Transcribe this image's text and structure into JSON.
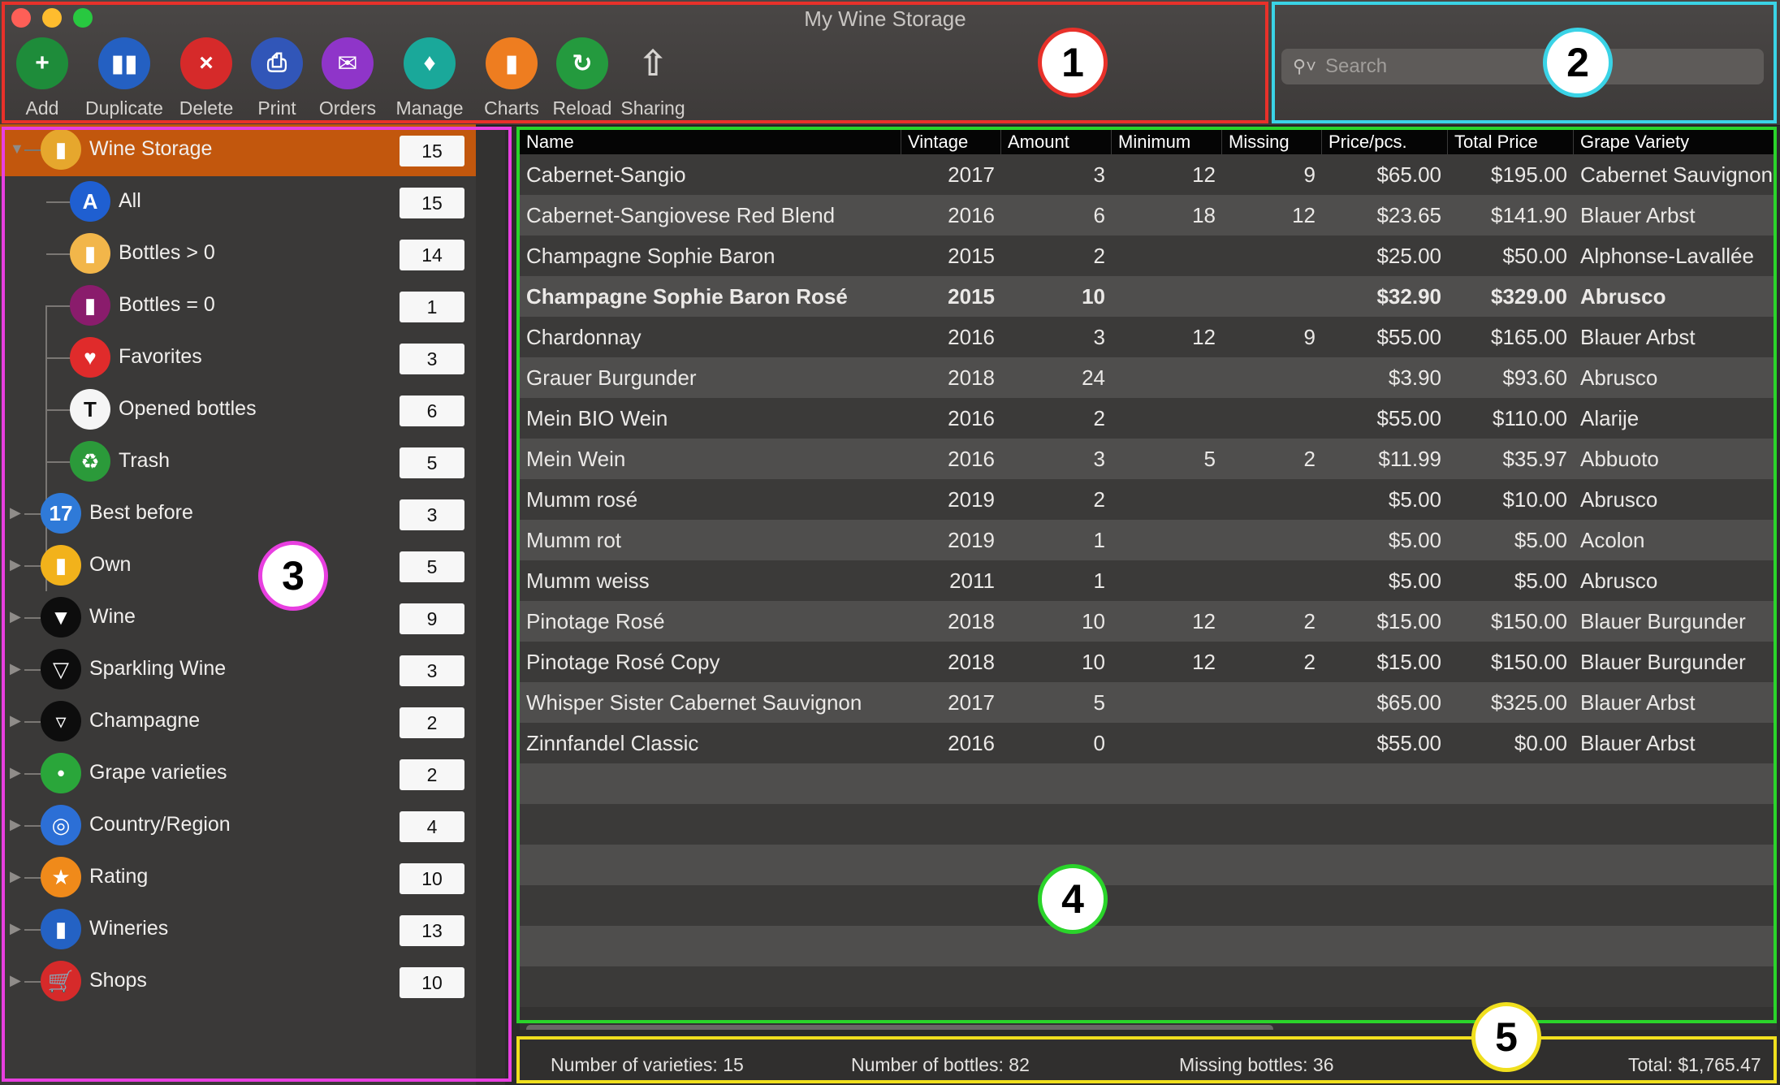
{
  "window": {
    "title": "My Wine Storage"
  },
  "toolbar": {
    "tools": [
      {
        "label": "Add",
        "icon": "add-bottle-icon",
        "color": "#1e8c3a"
      },
      {
        "label": "Duplicate",
        "icon": "duplicate-bottles-icon",
        "color": "#2460c2"
      },
      {
        "label": "Delete",
        "icon": "delete-bottle-icon",
        "color": "#d62a2a"
      },
      {
        "label": "Print",
        "icon": "printer-icon",
        "color": "#3156b8"
      },
      {
        "label": "Orders",
        "icon": "orders-cart-icon",
        "color": "#8f35c9"
      },
      {
        "label": "Manage",
        "icon": "manage-cart-icon",
        "color": "#1aa89a"
      },
      {
        "label": "Charts",
        "icon": "bar-chart-icon",
        "color": "#ee7d20"
      },
      {
        "label": "Reload",
        "icon": "reload-grapes-icon",
        "color": "#249a3e"
      },
      {
        "label": "Sharing",
        "icon": "share-icon",
        "color": "transparent"
      }
    ]
  },
  "search": {
    "placeholder": "Search"
  },
  "sidebar": {
    "root": {
      "label": "Wine Storage",
      "count": "15",
      "icon": "wine-rack-icon",
      "color": "#e6a72d"
    },
    "children": [
      {
        "label": "All",
        "count": "15",
        "icon": "letter-a-icon",
        "color": "#1f5fd1"
      },
      {
        "label": "Bottles > 0",
        "count": "14",
        "icon": "bottle-icon",
        "color": "#f2b64a"
      },
      {
        "label": "Bottles = 0",
        "count": "1",
        "icon": "empty-bottle-icon",
        "color": "#8a1c6c"
      },
      {
        "label": "Favorites",
        "count": "3",
        "icon": "heart-icon",
        "color": "#e02b2b"
      },
      {
        "label": "Opened bottles",
        "count": "6",
        "icon": "corkscrew-icon",
        "color": "#f5f5f5"
      },
      {
        "label": "Trash",
        "count": "5",
        "icon": "trash-icon",
        "color": "#2b9a3a"
      }
    ],
    "groups": [
      {
        "label": "Best before",
        "count": "3",
        "icon": "calendar-icon",
        "color": "#2f7ad8"
      },
      {
        "label": "Own",
        "count": "5",
        "icon": "own-bottle-icon",
        "color": "#f2b21b"
      },
      {
        "label": "Wine",
        "count": "9",
        "icon": "wine-glass-icon",
        "color": "#0d0d0d"
      },
      {
        "label": "Sparkling Wine",
        "count": "3",
        "icon": "flute-glass-icon",
        "color": "#0d0d0d"
      },
      {
        "label": "Champagne",
        "count": "2",
        "icon": "champagne-glass-icon",
        "color": "#0d0d0d"
      },
      {
        "label": "Grape varieties",
        "count": "2",
        "icon": "grapes-icon",
        "color": "#2aa63a"
      },
      {
        "label": "Country/Region",
        "count": "4",
        "icon": "globe-icon",
        "color": "#2c6fd6"
      },
      {
        "label": "Rating",
        "count": "10",
        "icon": "star-icon",
        "color": "#f08a1a"
      },
      {
        "label": "Wineries",
        "count": "13",
        "icon": "winery-icon",
        "color": "#2462c4"
      },
      {
        "label": "Shops",
        "count": "10",
        "icon": "cart-icon",
        "color": "#d62a2a"
      }
    ]
  },
  "table": {
    "columns": [
      "Name",
      "Vintage",
      "Amount",
      "Minimum",
      "Missing",
      "Price/pcs.",
      "Total Price",
      "Grape Variety"
    ],
    "rows": [
      {
        "name": "Cabernet-Sangio",
        "vintage": "2017",
        "amount": "3",
        "minimum": "12",
        "missing": "9",
        "price": "$65.00",
        "total": "$195.00",
        "grape": "Cabernet Sauvignon",
        "bold": false
      },
      {
        "name": "Cabernet-Sangiovese Red Blend",
        "vintage": "2016",
        "amount": "6",
        "minimum": "18",
        "missing": "12",
        "price": "$23.65",
        "total": "$141.90",
        "grape": "Blauer Arbst",
        "bold": false
      },
      {
        "name": "Champagne Sophie Baron",
        "vintage": "2015",
        "amount": "2",
        "minimum": "",
        "missing": "",
        "price": "$25.00",
        "total": "$50.00",
        "grape": "Alphonse-Lavallée",
        "bold": false
      },
      {
        "name": "Champagne Sophie Baron Rosé",
        "vintage": "2015",
        "amount": "10",
        "minimum": "",
        "missing": "",
        "price": "$32.90",
        "total": "$329.00",
        "grape": "Abrusco",
        "bold": true
      },
      {
        "name": "Chardonnay",
        "vintage": "2016",
        "amount": "3",
        "minimum": "12",
        "missing": "9",
        "price": "$55.00",
        "total": "$165.00",
        "grape": "Blauer Arbst",
        "bold": false
      },
      {
        "name": "Grauer Burgunder",
        "vintage": "2018",
        "amount": "24",
        "minimum": "",
        "missing": "",
        "price": "$3.90",
        "total": "$93.60",
        "grape": "Abrusco",
        "bold": false
      },
      {
        "name": "Mein BIO Wein",
        "vintage": "2016",
        "amount": "2",
        "minimum": "",
        "missing": "",
        "price": "$55.00",
        "total": "$110.00",
        "grape": "Alarije",
        "bold": false
      },
      {
        "name": "Mein Wein",
        "vintage": "2016",
        "amount": "3",
        "minimum": "5",
        "missing": "2",
        "price": "$11.99",
        "total": "$35.97",
        "grape": "Abbuoto",
        "bold": false
      },
      {
        "name": "Mumm rosé",
        "vintage": "2019",
        "amount": "2",
        "minimum": "",
        "missing": "",
        "price": "$5.00",
        "total": "$10.00",
        "grape": "Abrusco",
        "bold": false
      },
      {
        "name": "Mumm rot",
        "vintage": "2019",
        "amount": "1",
        "minimum": "",
        "missing": "",
        "price": "$5.00",
        "total": "$5.00",
        "grape": "Acolon",
        "bold": false
      },
      {
        "name": "Mumm weiss",
        "vintage": "2011",
        "amount": "1",
        "minimum": "",
        "missing": "",
        "price": "$5.00",
        "total": "$5.00",
        "grape": "Abrusco",
        "bold": false
      },
      {
        "name": "Pinotage Rosé",
        "vintage": "2018",
        "amount": "10",
        "minimum": "12",
        "missing": "2",
        "price": "$15.00",
        "total": "$150.00",
        "grape": "Blauer Burgunder",
        "bold": false
      },
      {
        "name": "Pinotage Rosé Copy",
        "vintage": "2018",
        "amount": "10",
        "minimum": "12",
        "missing": "2",
        "price": "$15.00",
        "total": "$150.00",
        "grape": "Blauer Burgunder",
        "bold": false
      },
      {
        "name": "Whisper Sister Cabernet Sauvignon",
        "vintage": "2017",
        "amount": "5",
        "minimum": "",
        "missing": "",
        "price": "$65.00",
        "total": "$325.00",
        "grape": "Blauer Arbst",
        "bold": false
      },
      {
        "name": "Zinnfandel Classic",
        "vintage": "2016",
        "amount": "0",
        "minimum": "",
        "missing": "",
        "price": "$55.00",
        "total": "$0.00",
        "grape": "Blauer Arbst",
        "bold": false
      }
    ]
  },
  "status": {
    "varieties": "Number of varieties: 15",
    "bottles": "Number of bottles: 82",
    "missing": "Missing bottles: 36",
    "total": "Total: $1,765.47"
  },
  "annotations": [
    {
      "label": "1",
      "color": "#e8312a"
    },
    {
      "label": "2",
      "color": "#3ad3e6"
    },
    {
      "label": "3",
      "color": "#e83fe0"
    },
    {
      "label": "4",
      "color": "#2ad42a"
    },
    {
      "label": "5",
      "color": "#f0df1e"
    }
  ]
}
